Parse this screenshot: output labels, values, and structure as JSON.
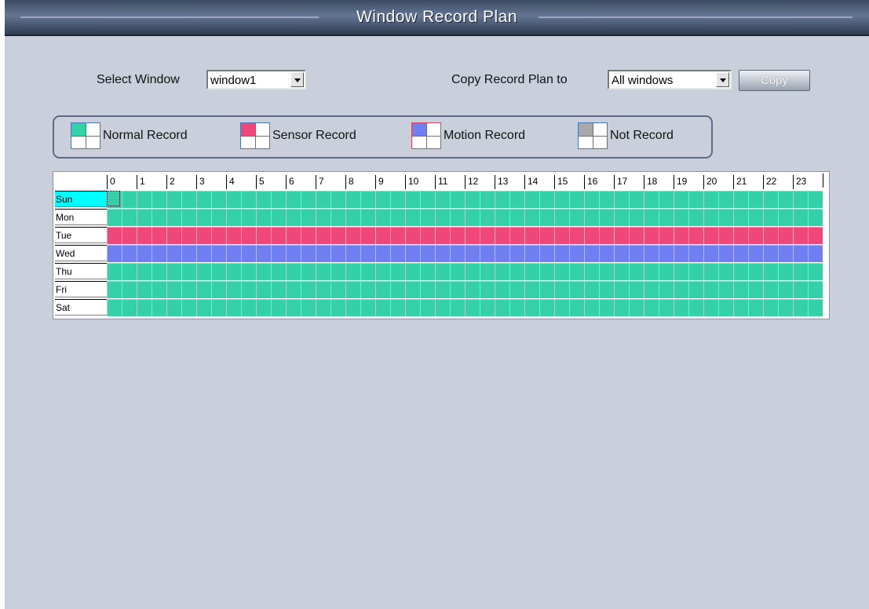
{
  "window": {
    "title": "Window Record Plan",
    "colors": {
      "titlebar": "#4a5a78",
      "background": "#c9d0dc"
    }
  },
  "select_window": {
    "label": "Select Window",
    "value": "window1"
  },
  "copy_plan": {
    "label": "Copy Record Plan to",
    "value": "All windows",
    "button": "Copy"
  },
  "legend": [
    {
      "label": "Normal Record",
      "color": "#34d0a8",
      "icon": "normal-record-icon"
    },
    {
      "label": "Sensor Record",
      "color": "#f0477a",
      "icon": "sensor-record-icon"
    },
    {
      "label": "Motion Record",
      "color": "#6f7ef0",
      "icon": "motion-record-icon"
    },
    {
      "label": "Not Record",
      "color": "#a9a9a9",
      "icon": "not-record-icon"
    }
  ],
  "schedule": {
    "hours": [
      "0",
      "1",
      "2",
      "3",
      "4",
      "5",
      "6",
      "7",
      "8",
      "9",
      "10",
      "11",
      "12",
      "13",
      "14",
      "15",
      "16",
      "17",
      "18",
      "19",
      "20",
      "21",
      "22",
      "23"
    ],
    "days": [
      {
        "label": "Sun",
        "mode": "normal",
        "selected": true
      },
      {
        "label": "Mon",
        "mode": "normal"
      },
      {
        "label": "Tue",
        "mode": "sensor"
      },
      {
        "label": "Wed",
        "mode": "motion"
      },
      {
        "label": "Thu",
        "mode": "normal"
      },
      {
        "label": "Fri",
        "mode": "normal"
      },
      {
        "label": "Sat",
        "mode": "normal"
      }
    ]
  }
}
